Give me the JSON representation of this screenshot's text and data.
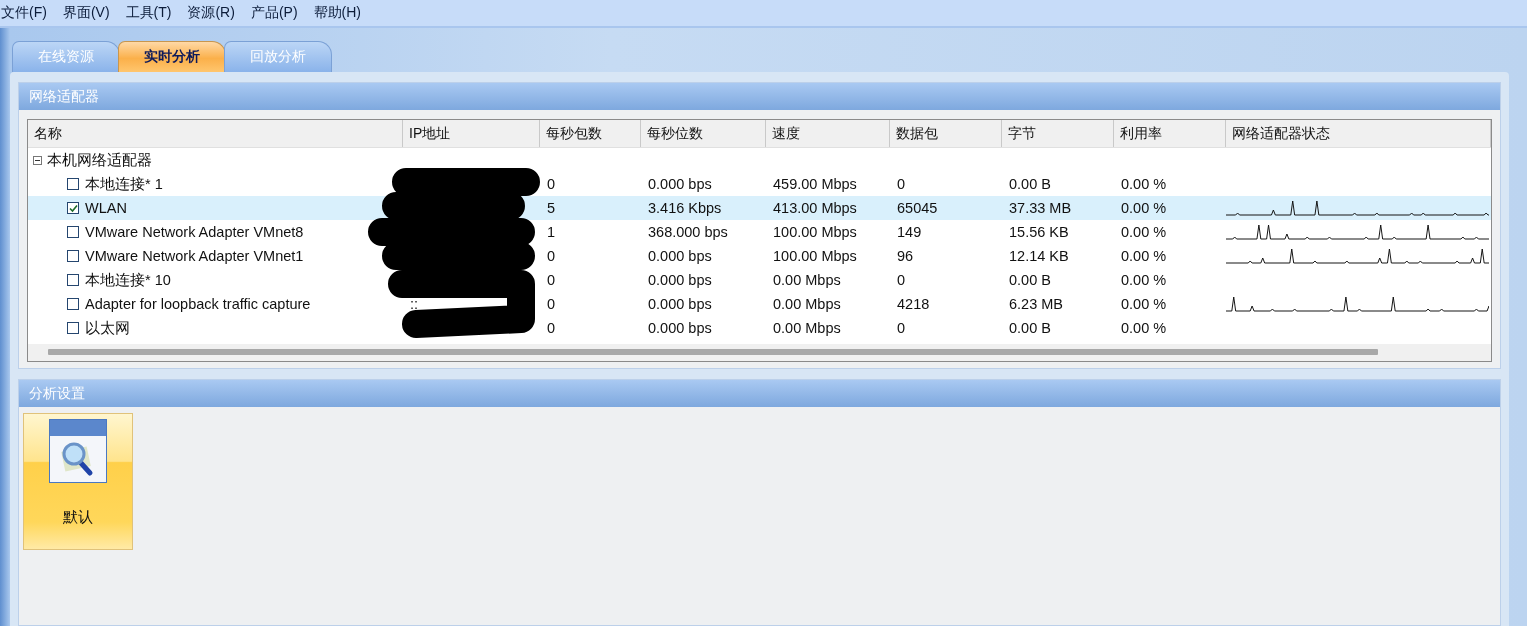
{
  "menu": [
    "文件(F)",
    "界面(V)",
    "工具(T)",
    "资源(R)",
    "产品(P)",
    "帮助(H)"
  ],
  "tabs": [
    {
      "label": "在线资源",
      "selected": false
    },
    {
      "label": "实时分析",
      "selected": true
    },
    {
      "label": "回放分析",
      "selected": false
    }
  ],
  "adapter_panel": {
    "title": "网络适配器",
    "columns": [
      "名称",
      "IP地址",
      "每秒包数",
      "每秒位数",
      "速度",
      "数据包",
      "字节",
      "利用率",
      "网络适配器状态"
    ],
    "groups": [
      {
        "label": "本机网络适配器",
        "expanded": true,
        "children": [
          {
            "name": "本地连接* 1",
            "checked": false,
            "selected": false,
            "pps": "0",
            "bps": "0.000 bps",
            "speed": "459.00 Mbps",
            "packets": "0",
            "bytes": "0.00 B",
            "usage": "0.00 %",
            "graph": false
          },
          {
            "name": "WLAN",
            "checked": true,
            "selected": true,
            "pps": "5",
            "bps": "3.416 Kbps",
            "speed": "413.00 Mbps",
            "packets": "65045",
            "bytes": "37.33 MB",
            "usage": "0.00 %",
            "graph": true
          },
          {
            "name": "VMware Network Adapter VMnet8",
            "checked": false,
            "selected": false,
            "pps": "1",
            "bps": "368.000 bps",
            "speed": "100.00 Mbps",
            "packets": "149",
            "bytes": "15.56 KB",
            "usage": "0.00 %",
            "graph": true
          },
          {
            "name": "VMware Network Adapter VMnet1",
            "checked": false,
            "selected": false,
            "pps": "0",
            "bps": "0.000 bps",
            "speed": "100.00 Mbps",
            "packets": "96",
            "bytes": "12.14 KB",
            "usage": "0.00 %",
            "graph": true
          },
          {
            "name": "本地连接* 10",
            "checked": false,
            "selected": false,
            "pps": "0",
            "bps": "0.000 bps",
            "speed": "0.00 Mbps",
            "packets": "0",
            "bytes": "0.00 B",
            "usage": "0.00 %",
            "graph": false
          },
          {
            "name": "Adapter for loopback traffic capture",
            "checked": false,
            "selected": false,
            "ip": "::",
            "pps": "0",
            "bps": "0.000 bps",
            "speed": "0.00 Mbps",
            "packets": "4218",
            "bytes": "6.23 MB",
            "usage": "0.00 %",
            "graph": true
          },
          {
            "name": "以太网",
            "checked": false,
            "selected": false,
            "pps": "0",
            "bps": "0.000 bps",
            "speed": "0.00 Mbps",
            "packets": "0",
            "bytes": "0.00 B",
            "usage": "0.00 %",
            "graph": false
          }
        ]
      }
    ]
  },
  "settings_panel": {
    "title": "分析设置",
    "profiles": [
      {
        "label": "默认",
        "selected": true
      }
    ]
  }
}
